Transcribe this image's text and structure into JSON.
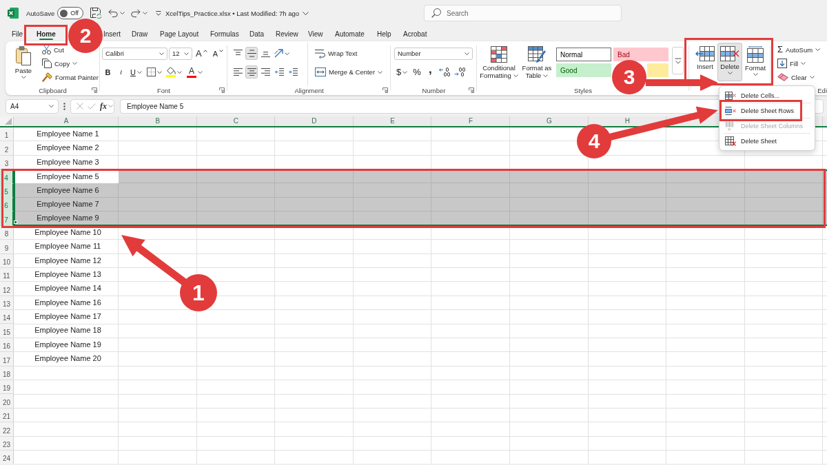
{
  "title_bar": {
    "autosave_label": "AutoSave",
    "autosave_toggle": {
      "label": "Off",
      "on": false
    },
    "document_title": "XcelTips_Practice.xlsx • Last Modified: 7h ago",
    "search": {
      "placeholder": "Search"
    }
  },
  "tabs": [
    {
      "label": "File",
      "selected": false
    },
    {
      "label": "Home",
      "selected": true
    },
    {
      "label": "Insert",
      "selected": false
    },
    {
      "label": "Draw",
      "selected": false
    },
    {
      "label": "Page Layout",
      "selected": false
    },
    {
      "label": "Formulas",
      "selected": false
    },
    {
      "label": "Data",
      "selected": false
    },
    {
      "label": "Review",
      "selected": false
    },
    {
      "label": "View",
      "selected": false
    },
    {
      "label": "Automate",
      "selected": false
    },
    {
      "label": "Help",
      "selected": false
    },
    {
      "label": "Acrobat",
      "selected": false
    }
  ],
  "ribbon": [
    {
      "label": "Clipboard",
      "launcher": true,
      "sections": [
        {
          "kind": "large",
          "label": "Paste",
          "caret": true,
          "pressed": false
        },
        {
          "kind": "stack",
          "lines": [
            {
              "items": [
                {
                  "kind": "small",
                  "label": "Cut",
                  "pressed": false
                }
              ]
            },
            {
              "items": [
                {
                  "kind": "small",
                  "label": "Copy",
                  "caret": true,
                  "pressed": false
                }
              ]
            },
            {
              "items": [
                {
                  "kind": "small",
                  "label": "Format Painter",
                  "pressed": false
                }
              ]
            }
          ]
        }
      ]
    },
    {
      "label": "Font",
      "launcher": true,
      "sections": [
        {
          "kind": "stack",
          "lines": [
            {
              "items": [
                {
                  "kind": "combo",
                  "value": "Calibri"
                },
                {
                  "kind": "combo",
                  "value": "12"
                },
                {
                  "kind": "glyph",
                  "text": "A",
                  "pressed": false
                },
                {
                  "kind": "glyph",
                  "text": "A",
                  "pressed": false
                }
              ]
            },
            {
              "items": [
                {
                  "kind": "glyph",
                  "text": "B",
                  "pressed": false
                },
                {
                  "kind": "glyph",
                  "text": "I",
                  "pressed": false
                },
                {
                  "kind": "glyph",
                  "text": "U",
                  "caret": true,
                  "pressed": false
                },
                {
                  "kind": "icon",
                  "caret": true,
                  "pressed": false
                },
                {
                  "kind": "icon",
                  "caret": true,
                  "pressed": false,
                  "color": "#ffff00"
                },
                {
                  "kind": "glyph",
                  "text": "A",
                  "caret": true,
                  "pressed": false,
                  "color": "#ff0000"
                }
              ]
            }
          ]
        }
      ]
    },
    {
      "label": "Alignment",
      "launcher": true,
      "sections": [
        {
          "kind": "stack",
          "lines": [
            {
              "items": [
                {
                  "kind": "icon",
                  "pressed": false
                },
                {
                  "kind": "icon",
                  "pressed": true
                },
                {
                  "kind": "icon",
                  "pressed": false
                },
                {
                  "kind": "icon",
                  "caret": true,
                  "pressed": false
                }
              ]
            },
            {
              "items": [
                {
                  "kind": "icon",
                  "pressed": false
                },
                {
                  "kind": "icon",
                  "pressed": true
                },
                {
                  "kind": "icon",
                  "pressed": false
                },
                {
                  "kind": "icon",
                  "pressed": false
                },
                {
                  "kind": "icon",
                  "pressed": false
                }
              ]
            }
          ]
        },
        {
          "kind": "stack",
          "lines": [
            {
              "items": [
                {
                  "kind": "small",
                  "label": "Wrap Text",
                  "pressed": false
                }
              ]
            },
            {
              "items": [
                {
                  "kind": "small",
                  "label": "Merge & Center",
                  "caret": true,
                  "pressed": false
                }
              ]
            }
          ]
        }
      ]
    },
    {
      "label": "Number",
      "launcher": true,
      "sections": [
        {
          "kind": "stack",
          "lines": [
            {
              "items": [
                {
                  "kind": "combo",
                  "value": "Number"
                }
              ]
            },
            {
              "items": [
                {
                  "kind": "glyph",
                  "text": "$",
                  "caret": true,
                  "pressed": false
                },
                {
                  "kind": "glyph",
                  "text": "%",
                  "pressed": false
                },
                {
                  "kind": "glyph",
                  "text": ",",
                  "pressed": false
                },
                {
                  "kind": "icon",
                  "pressed": false
                },
                {
                  "kind": "icon",
                  "pressed": false
                }
              ]
            }
          ]
        }
      ]
    },
    {
      "label": "Styles",
      "sections": [
        {
          "kind": "large",
          "label": "Conditional Formatting",
          "caret": true,
          "pressed": false
        },
        {
          "kind": "large",
          "label": "Format as Table",
          "caret": true,
          "pressed": false
        },
        {
          "kind": "gallery",
          "styles": [
            {
              "kind": "normal",
              "label": "Normal",
              "color": "#ffffff",
              "selected": true
            },
            {
              "kind": "bad",
              "label": "Bad",
              "color": "#ffc7ce",
              "selected": false
            },
            {
              "kind": "good",
              "label": "Good",
              "color": "#c6efce",
              "selected": false
            },
            {
              "kind": "neutral",
              "color": "#ffeb9c",
              "selected": false
            }
          ]
        },
        {
          "kind": "more"
        }
      ]
    },
    {
      "sections": [
        {
          "kind": "large",
          "label": "Insert",
          "pressed": false
        },
        {
          "kind": "large",
          "label": "Delete",
          "caret": true,
          "pressed": true
        },
        {
          "kind": "large",
          "label": "Format",
          "caret": true,
          "pressed": false
        }
      ]
    },
    {
      "label": "Edi",
      "sections": [
        {
          "kind": "stack",
          "lines": [
            {
              "items": [
                {
                  "kind": "small",
                  "glyph": "Σ",
                  "label": "AutoSum",
                  "caret": true,
                  "pressed": false
                }
              ]
            },
            {
              "items": [
                {
                  "kind": "small",
                  "label": "Fill",
                  "caret": true,
                  "pressed": false
                }
              ]
            },
            {
              "items": [
                {
                  "kind": "small",
                  "label": "Clear",
                  "caret": true,
                  "pressed": false
                }
              ]
            }
          ]
        }
      ]
    }
  ],
  "formula_bar": {
    "name_box": "A4",
    "edit_buttons": [
      {
        "disabled": true
      },
      {
        "disabled": true
      }
    ],
    "function_label": "fx",
    "formula": "Employee Name 5"
  },
  "sheet": {
    "columns": [
      "A",
      "B",
      "C",
      "D",
      "E",
      "F",
      "G",
      "H"
    ],
    "rows": [
      {
        "header": "1",
        "selected": false,
        "cells": [
          {
            "text": "Employee Name 1",
            "active": false
          }
        ]
      },
      {
        "header": "2",
        "selected": false,
        "cells": [
          {
            "text": "Employee Name 2",
            "active": false
          }
        ]
      },
      {
        "header": "3",
        "selected": false,
        "cells": [
          {
            "text": "Employee Name 3",
            "active": false
          }
        ]
      },
      {
        "header": "4",
        "selected": true,
        "cells": [
          {
            "text": "Employee Name 5",
            "active": true
          }
        ]
      },
      {
        "header": "5",
        "selected": true,
        "cells": [
          {
            "text": "Employee Name 6",
            "active": false
          }
        ]
      },
      {
        "header": "6",
        "selected": true,
        "cells": [
          {
            "text": "Employee Name 7",
            "active": false
          }
        ]
      },
      {
        "header": "7",
        "selected": true,
        "cells": [
          {
            "text": "Employee Name 9",
            "active": false
          }
        ]
      },
      {
        "header": "8",
        "selected": false,
        "cells": [
          {
            "text": "Employee Name 10",
            "active": false
          }
        ]
      },
      {
        "header": "9",
        "selected": false,
        "cells": [
          {
            "text": "Employee Name 11",
            "active": false
          }
        ]
      },
      {
        "header": "10",
        "selected": false,
        "cells": [
          {
            "text": "Employee Name 12",
            "active": false
          }
        ]
      },
      {
        "header": "11",
        "selected": false,
        "cells": [
          {
            "text": "Employee Name 13",
            "active": false
          }
        ]
      },
      {
        "header": "12",
        "selected": false,
        "cells": [
          {
            "text": "Employee Name 14",
            "active": false
          }
        ]
      },
      {
        "header": "13",
        "selected": false,
        "cells": [
          {
            "text": "Employee Name 16",
            "active": false
          }
        ]
      },
      {
        "header": "14",
        "selected": false,
        "cells": [
          {
            "text": "Employee Name 17",
            "active": false
          }
        ]
      },
      {
        "header": "15",
        "selected": false,
        "cells": [
          {
            "text": "Employee Name 18",
            "active": false
          }
        ]
      },
      {
        "header": "16",
        "selected": false,
        "cells": [
          {
            "text": "Employee Name 19",
            "active": false
          }
        ]
      },
      {
        "header": "17",
        "selected": false,
        "cells": [
          {
            "text": "Employee Name 20",
            "active": false
          }
        ]
      },
      {
        "header": "18",
        "selected": false
      },
      {
        "header": "19",
        "selected": false
      },
      {
        "header": "20",
        "selected": false
      },
      {
        "header": "21",
        "selected": false
      },
      {
        "header": "22",
        "selected": false
      },
      {
        "header": "23",
        "selected": false
      },
      {
        "header": "24",
        "selected": false
      }
    ]
  },
  "delete_menu": {
    "items": [
      {
        "label": "Delete Cells...",
        "disabled": false
      },
      {
        "label": "Delete Sheet Rows",
        "disabled": false
      },
      {
        "label": "Delete Sheet Columns",
        "disabled": true
      },
      {
        "label": "Delete Sheet",
        "disabled": false
      }
    ]
  },
  "annotations": [
    {
      "number": "1",
      "arrow": true
    },
    {
      "number": "2",
      "arrow": false
    },
    {
      "number": "3",
      "arrow": true
    },
    {
      "number": "4",
      "arrow": true
    }
  ]
}
